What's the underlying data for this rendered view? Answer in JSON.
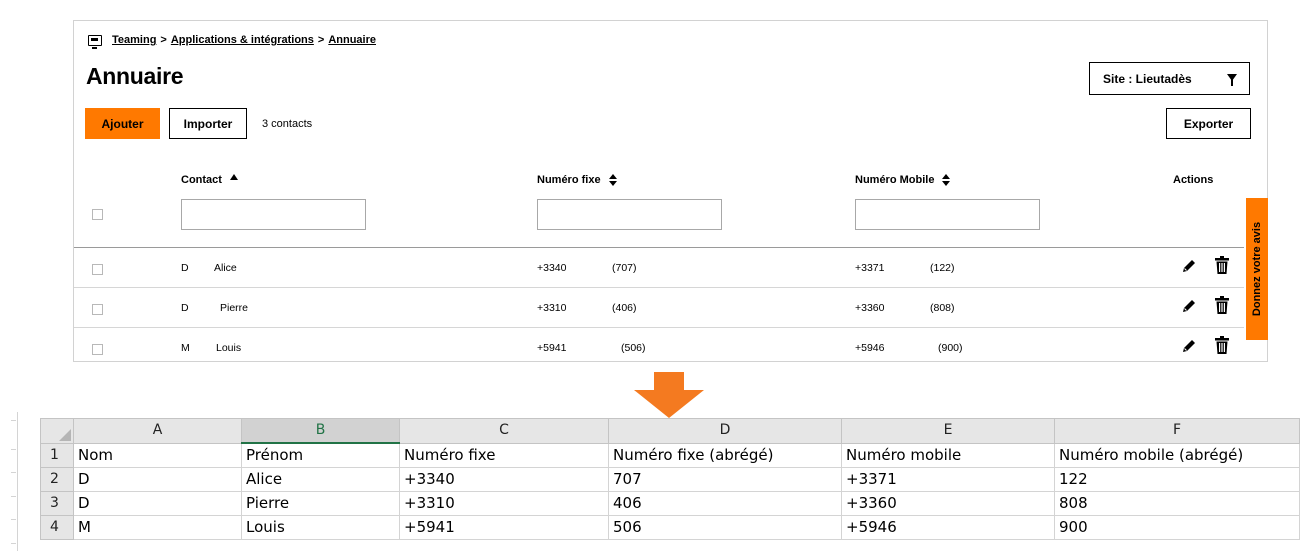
{
  "breadcrumb": [
    "Teaming",
    "Applications & intégrations",
    "Annuaire"
  ],
  "breadcrumb_sep": ">",
  "page_title": "Annuaire",
  "site_filter": "Site : Lieutadès",
  "toolbar": {
    "add": "Ajouter",
    "import": "Importer",
    "count": "3 contacts",
    "export": "Exporter"
  },
  "table": {
    "headers": {
      "contact": "Contact",
      "fixe": "Numéro fixe",
      "mobile": "Numéro Mobile",
      "actions": "Actions"
    },
    "rows": [
      {
        "initial": "D",
        "name": "Alice",
        "fixe": "+3340",
        "fixe_short": "(707)",
        "mobile": "+3371",
        "mobile_short": "(122)"
      },
      {
        "initial": "D",
        "name": "Pierre",
        "fixe": "+3310",
        "fixe_short": "(406)",
        "mobile": "+3360",
        "mobile_short": "(808)"
      },
      {
        "initial": "M",
        "name": "Louis",
        "fixe": "+5941",
        "fixe_short": "(506)",
        "mobile": "+5946",
        "mobile_short": "(900)"
      }
    ]
  },
  "feedback_tab": "Donnez votre avis",
  "colors": {
    "accent": "#ff7900",
    "excel_green": "#217346"
  },
  "icons": {
    "breadcrumb": "monitor-icon",
    "filter": "funnel-icon",
    "edit": "pencil-icon",
    "delete": "trash-icon",
    "arrow": "down-arrow-icon"
  },
  "spreadsheet": {
    "columns": [
      "A",
      "B",
      "C",
      "D",
      "E",
      "F"
    ],
    "selected_column": "B",
    "rows": [
      {
        "num": "1",
        "cells": [
          "Nom",
          "Prénom",
          "Numéro fixe",
          "Numéro fixe (abrégé)",
          "Numéro mobile",
          "Numéro mobile (abrégé)"
        ]
      },
      {
        "num": "2",
        "cells": [
          "D",
          "Alice",
          "+3340",
          "707",
          "+3371",
          "122"
        ]
      },
      {
        "num": "3",
        "cells": [
          "D",
          "Pierre",
          "+3310",
          "406",
          "+3360",
          "808"
        ]
      },
      {
        "num": "4",
        "cells": [
          "M",
          "Louis",
          "+5941",
          "506",
          "+5946",
          "900"
        ]
      }
    ]
  }
}
